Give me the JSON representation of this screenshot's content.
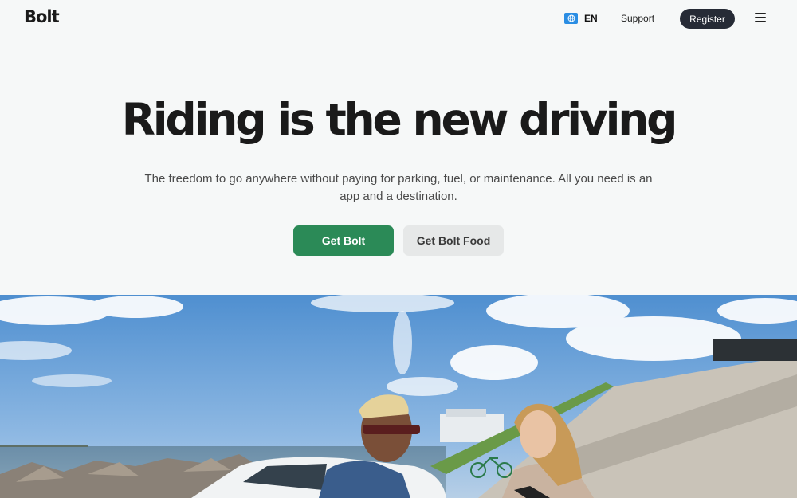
{
  "header": {
    "logo": "Bolt",
    "language": "EN",
    "support": "Support",
    "register": "Register"
  },
  "hero": {
    "title": "Riding is the new driving",
    "subtitle": "The freedom to go anywhere without paying for parking, fuel, or maintenance. All you need is an app and a destination.",
    "primary_button": "Get Bolt",
    "secondary_button": "Get Bolt Food"
  },
  "colors": {
    "background": "#f6f8f8",
    "primary": "#2b8a57",
    "register": "#262b36",
    "secondary": "#e6e8e8",
    "globe": "#2a8de3"
  },
  "icons": [
    "globe-icon",
    "hamburger-menu-icon"
  ]
}
